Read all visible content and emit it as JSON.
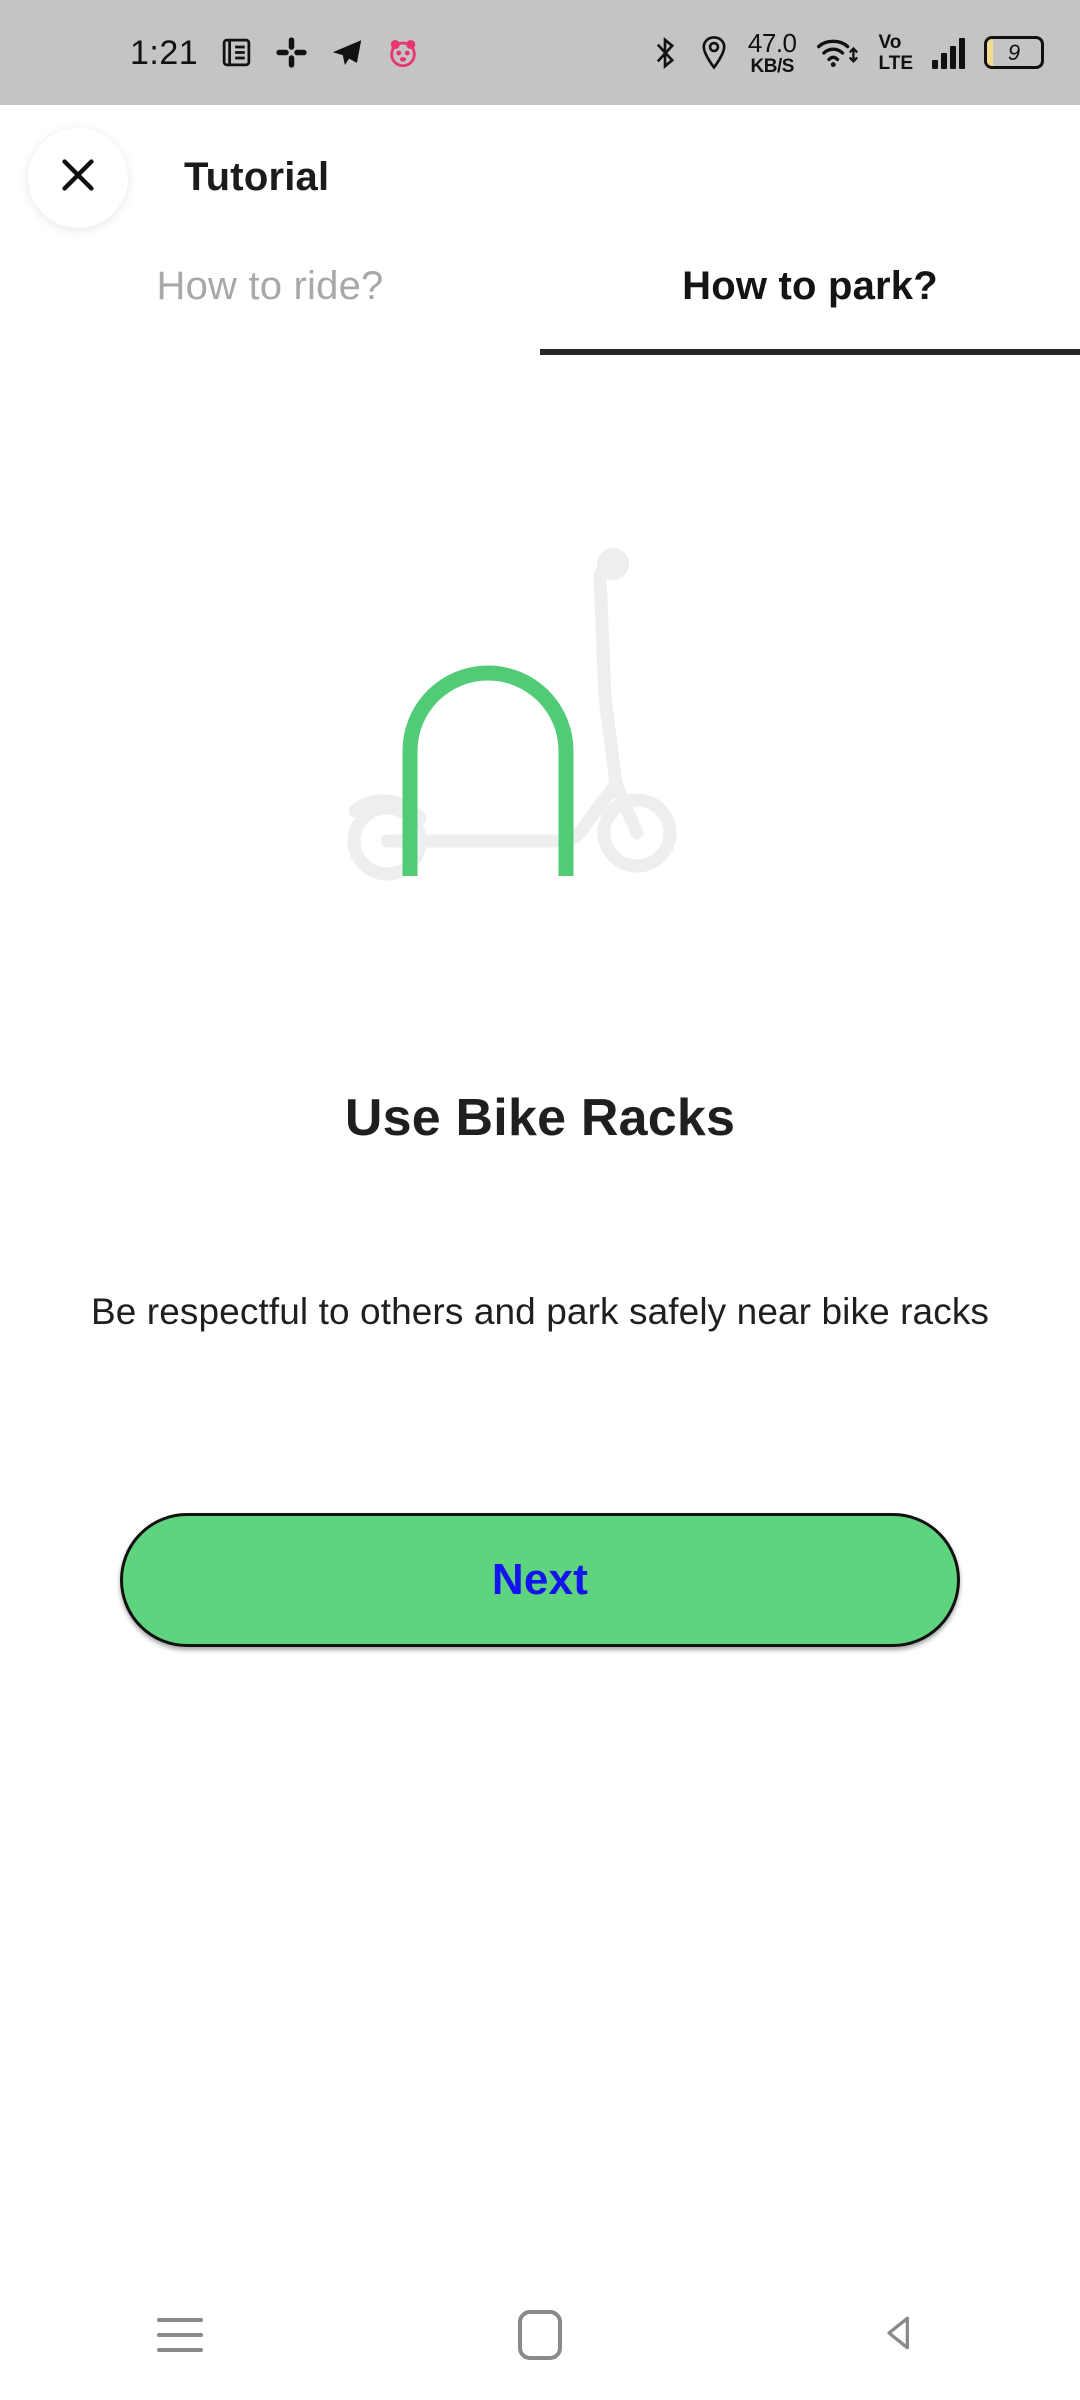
{
  "status_bar": {
    "clock": "1:21",
    "left_icons": [
      "notes-icon",
      "slack-icon",
      "telegram-icon",
      "foodpanda-icon"
    ],
    "right_icons": [
      "bluetooth-icon",
      "location-icon",
      "wifi-icon",
      "signal-icon",
      "battery-icon"
    ],
    "network_speed_value": "47.0",
    "network_speed_unit": "KB/S",
    "volte_line1": "Vo",
    "volte_line2": "LTE",
    "battery_level": "9",
    "battery_fill_color": "#f2dd8e",
    "bar_background": "#c4c4c4"
  },
  "header": {
    "title": "Tutorial",
    "close_icon": "close-icon"
  },
  "tabs": [
    {
      "label": "How to ride?",
      "active": false
    },
    {
      "label": "How to park?",
      "active": true
    }
  ],
  "illustration": {
    "name": "scooter-at-bike-rack-illustration",
    "rack_color": "#52CB77",
    "scooter_color": "#eceef0"
  },
  "content": {
    "heading": "Use Bike Racks",
    "description": "Be respectful to others and park safely near bike racks"
  },
  "next_button": {
    "label": "Next",
    "background": "#5ED47F",
    "text_color": "#1414f0"
  },
  "nav_bar": {
    "recents_icon": "recents-icon",
    "home_icon": "home-icon",
    "back_icon": "back-icon"
  }
}
